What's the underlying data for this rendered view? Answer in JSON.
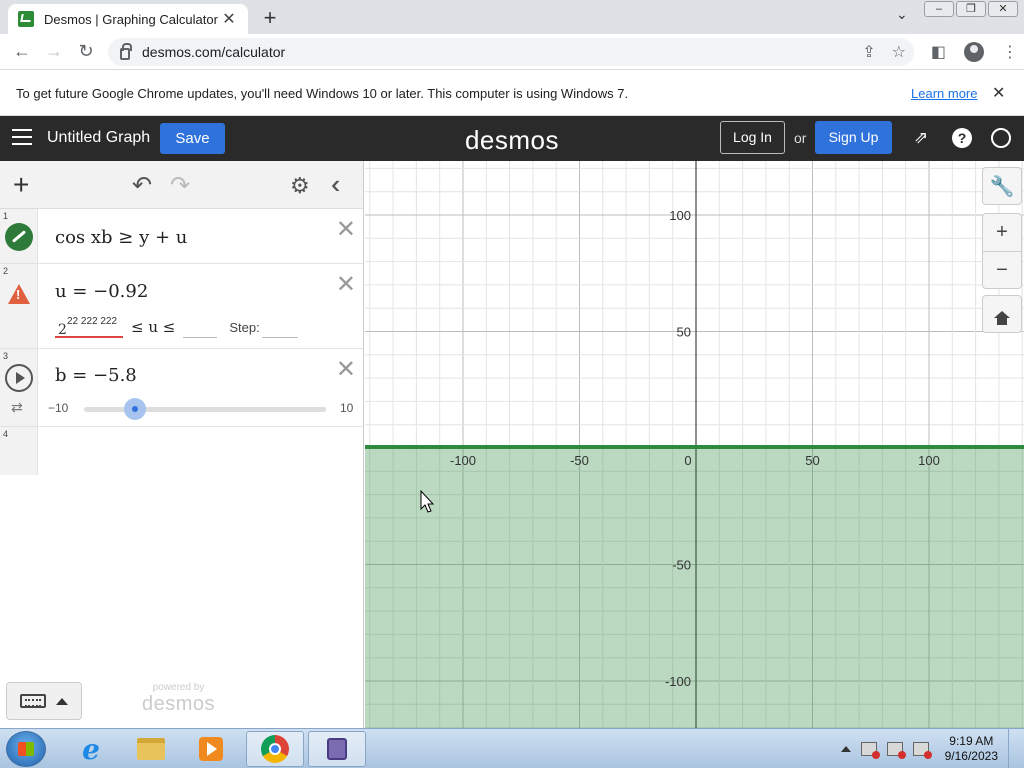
{
  "browser": {
    "tab_title": "Desmos | Graphing Calculator",
    "tab_close": "✕",
    "new_tab": "+",
    "url": "desmos.com/calculator",
    "infobar_text": "To get future Google Chrome updates, you'll need Windows 10 or later. This computer is using Windows 7.",
    "infobar_link": "Learn more"
  },
  "header": {
    "graph_title": "Untitled Graph",
    "save_label": "Save",
    "logo": "desmos",
    "login_label": "Log In",
    "or_text": "or",
    "signup_label": "Sign Up"
  },
  "expressions": [
    {
      "index": "1",
      "latex_text": "cos xb ≥ y + u",
      "icon": "line-style-icon",
      "color": "#2d7a3a"
    },
    {
      "index": "2",
      "latex_text": "u = −0.92",
      "icon": "warning-icon",
      "lower_base": "2",
      "lower_exponent": "22 222 222",
      "mid": "≤ u ≤",
      "step_label": "Step:"
    },
    {
      "index": "3",
      "latex_text": "b = −5.8",
      "icon": "play-icon",
      "slider_min": "−10",
      "slider_max": "10",
      "slider_value": -5.8
    },
    {
      "index": "4"
    }
  ],
  "panel": {
    "powered_small": "powered by",
    "powered_big": "desmos"
  },
  "graph": {
    "x_ticks": [
      "-100",
      "-50",
      "0",
      "50",
      "100"
    ],
    "y_ticks": [
      "100",
      "50",
      "-50",
      "-100"
    ],
    "shade_color": "#2d8a3e",
    "inequality": "y ≤ cos(xb) − u"
  },
  "taskbar": {
    "time": "9:19 AM",
    "date": "9/16/2023"
  }
}
